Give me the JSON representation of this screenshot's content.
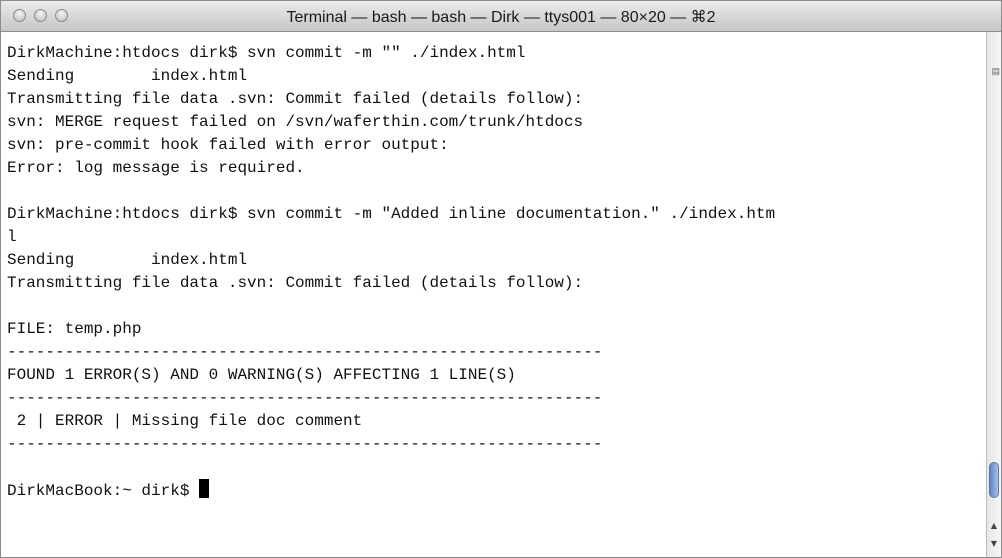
{
  "window": {
    "title": "Terminal — bash — bash — Dirk — ttys001 — 80×20 — ⌘2"
  },
  "terminal": {
    "lines": [
      "DirkMachine:htdocs dirk$ svn commit -m \"\" ./index.html",
      "Sending        index.html",
      "Transmitting file data .svn: Commit failed (details follow):",
      "svn: MERGE request failed on /svn/waferthin.com/trunk/htdocs",
      "svn: pre-commit hook failed with error output:",
      "Error: log message is required.",
      "",
      "DirkMachine:htdocs dirk$ svn commit -m \"Added inline documentation.\" ./index.htm",
      "l",
      "Sending        index.html",
      "Transmitting file data .svn: Commit failed (details follow):",
      "",
      "FILE: temp.php",
      "--------------------------------------------------------------",
      "FOUND 1 ERROR(S) AND 0 WARNING(S) AFFECTING 1 LINE(S)",
      "--------------------------------------------------------------",
      " 2 | ERROR | Missing file doc comment",
      "--------------------------------------------------------------",
      ""
    ],
    "prompt": "DirkMacBook:~ dirk$ "
  }
}
